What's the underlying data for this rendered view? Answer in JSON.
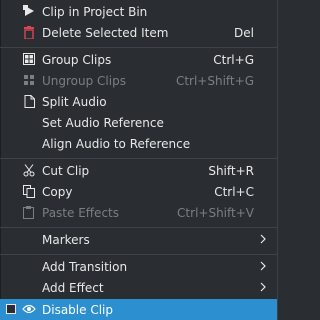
{
  "menu": {
    "items": {
      "clip_in_project_bin": {
        "label": "Clip in Project Bin",
        "icon": "clip-bin-icon"
      },
      "delete_selected_item": {
        "label": "Delete Selected Item",
        "shortcut": "Del",
        "icon": "trash-icon",
        "icon_color": "#da4453"
      },
      "group_clips": {
        "label": "Group Clips",
        "shortcut": "Ctrl+G",
        "icon": "group-icon"
      },
      "ungroup_clips": {
        "label": "Ungroup Clips",
        "shortcut": "Ctrl+Shift+G",
        "icon": "ungroup-icon",
        "disabled": true
      },
      "split_audio": {
        "label": "Split Audio",
        "icon": "document-icon"
      },
      "set_audio_reference": {
        "label": "Set Audio Reference"
      },
      "align_audio": {
        "label": "Align Audio to Reference"
      },
      "cut_clip": {
        "label": "Cut Clip",
        "shortcut": "Shift+R",
        "icon": "scissors-icon"
      },
      "copy": {
        "label": "Copy",
        "shortcut": "Ctrl+C",
        "icon": "copy-icon"
      },
      "paste_effects": {
        "label": "Paste Effects",
        "shortcut": "Ctrl+Shift+V",
        "icon": "paste-icon",
        "disabled": true
      },
      "markers": {
        "label": "Markers",
        "submenu": true
      },
      "add_transition": {
        "label": "Add Transition",
        "submenu": true
      },
      "add_effect": {
        "label": "Add Effect",
        "submenu": true
      },
      "disable_clip": {
        "label": "Disable Clip",
        "icon": "eye-icon",
        "highlighted": true,
        "checked": false
      }
    }
  },
  "colors": {
    "background": "#2a2e32",
    "text": "#e8e8e8",
    "disabled_text": "#7b7f84",
    "highlight": "#2b8fd0",
    "separator": "#3e4348"
  }
}
